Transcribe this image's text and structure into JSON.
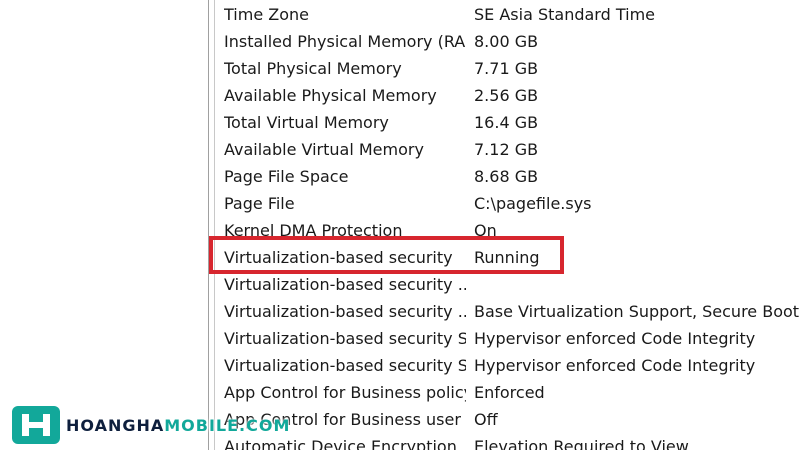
{
  "system_summary": {
    "rows": [
      {
        "item": "Time Zone",
        "value": "SE Asia Standard Time"
      },
      {
        "item": "Installed Physical Memory (RA...",
        "value": "8.00 GB"
      },
      {
        "item": "Total Physical Memory",
        "value": "7.71 GB"
      },
      {
        "item": "Available Physical Memory",
        "value": "2.56 GB"
      },
      {
        "item": "Total Virtual Memory",
        "value": "16.4 GB"
      },
      {
        "item": "Available Virtual Memory",
        "value": "7.12 GB"
      },
      {
        "item": "Page File Space",
        "value": "8.68 GB"
      },
      {
        "item": "Page File",
        "value": "C:\\pagefile.sys"
      },
      {
        "item": "Kernel DMA Protection",
        "value": "On"
      },
      {
        "item": "Virtualization-based security",
        "value": "Running"
      },
      {
        "item": "Virtualization-based security ...",
        "value": ""
      },
      {
        "item": "Virtualization-based security ...",
        "value": "Base Virtualization Support, Secure Boot"
      },
      {
        "item": "Virtualization-based security S...",
        "value": "Hypervisor enforced Code Integrity"
      },
      {
        "item": "Virtualization-based security S...",
        "value": "Hypervisor enforced Code Integrity"
      },
      {
        "item": "App Control for Business policy",
        "value": "Enforced"
      },
      {
        "item": "App Control for Business user ...",
        "value": "Off"
      },
      {
        "item": "Automatic Device Encryption ...",
        "value": "Elevation Required to View"
      }
    ]
  },
  "watermark": {
    "text_part1": "HOANGHA",
    "text_part2": "MOBILE.COM"
  },
  "colors": {
    "highlight": "#d7262e",
    "brand": "#12a89a"
  }
}
